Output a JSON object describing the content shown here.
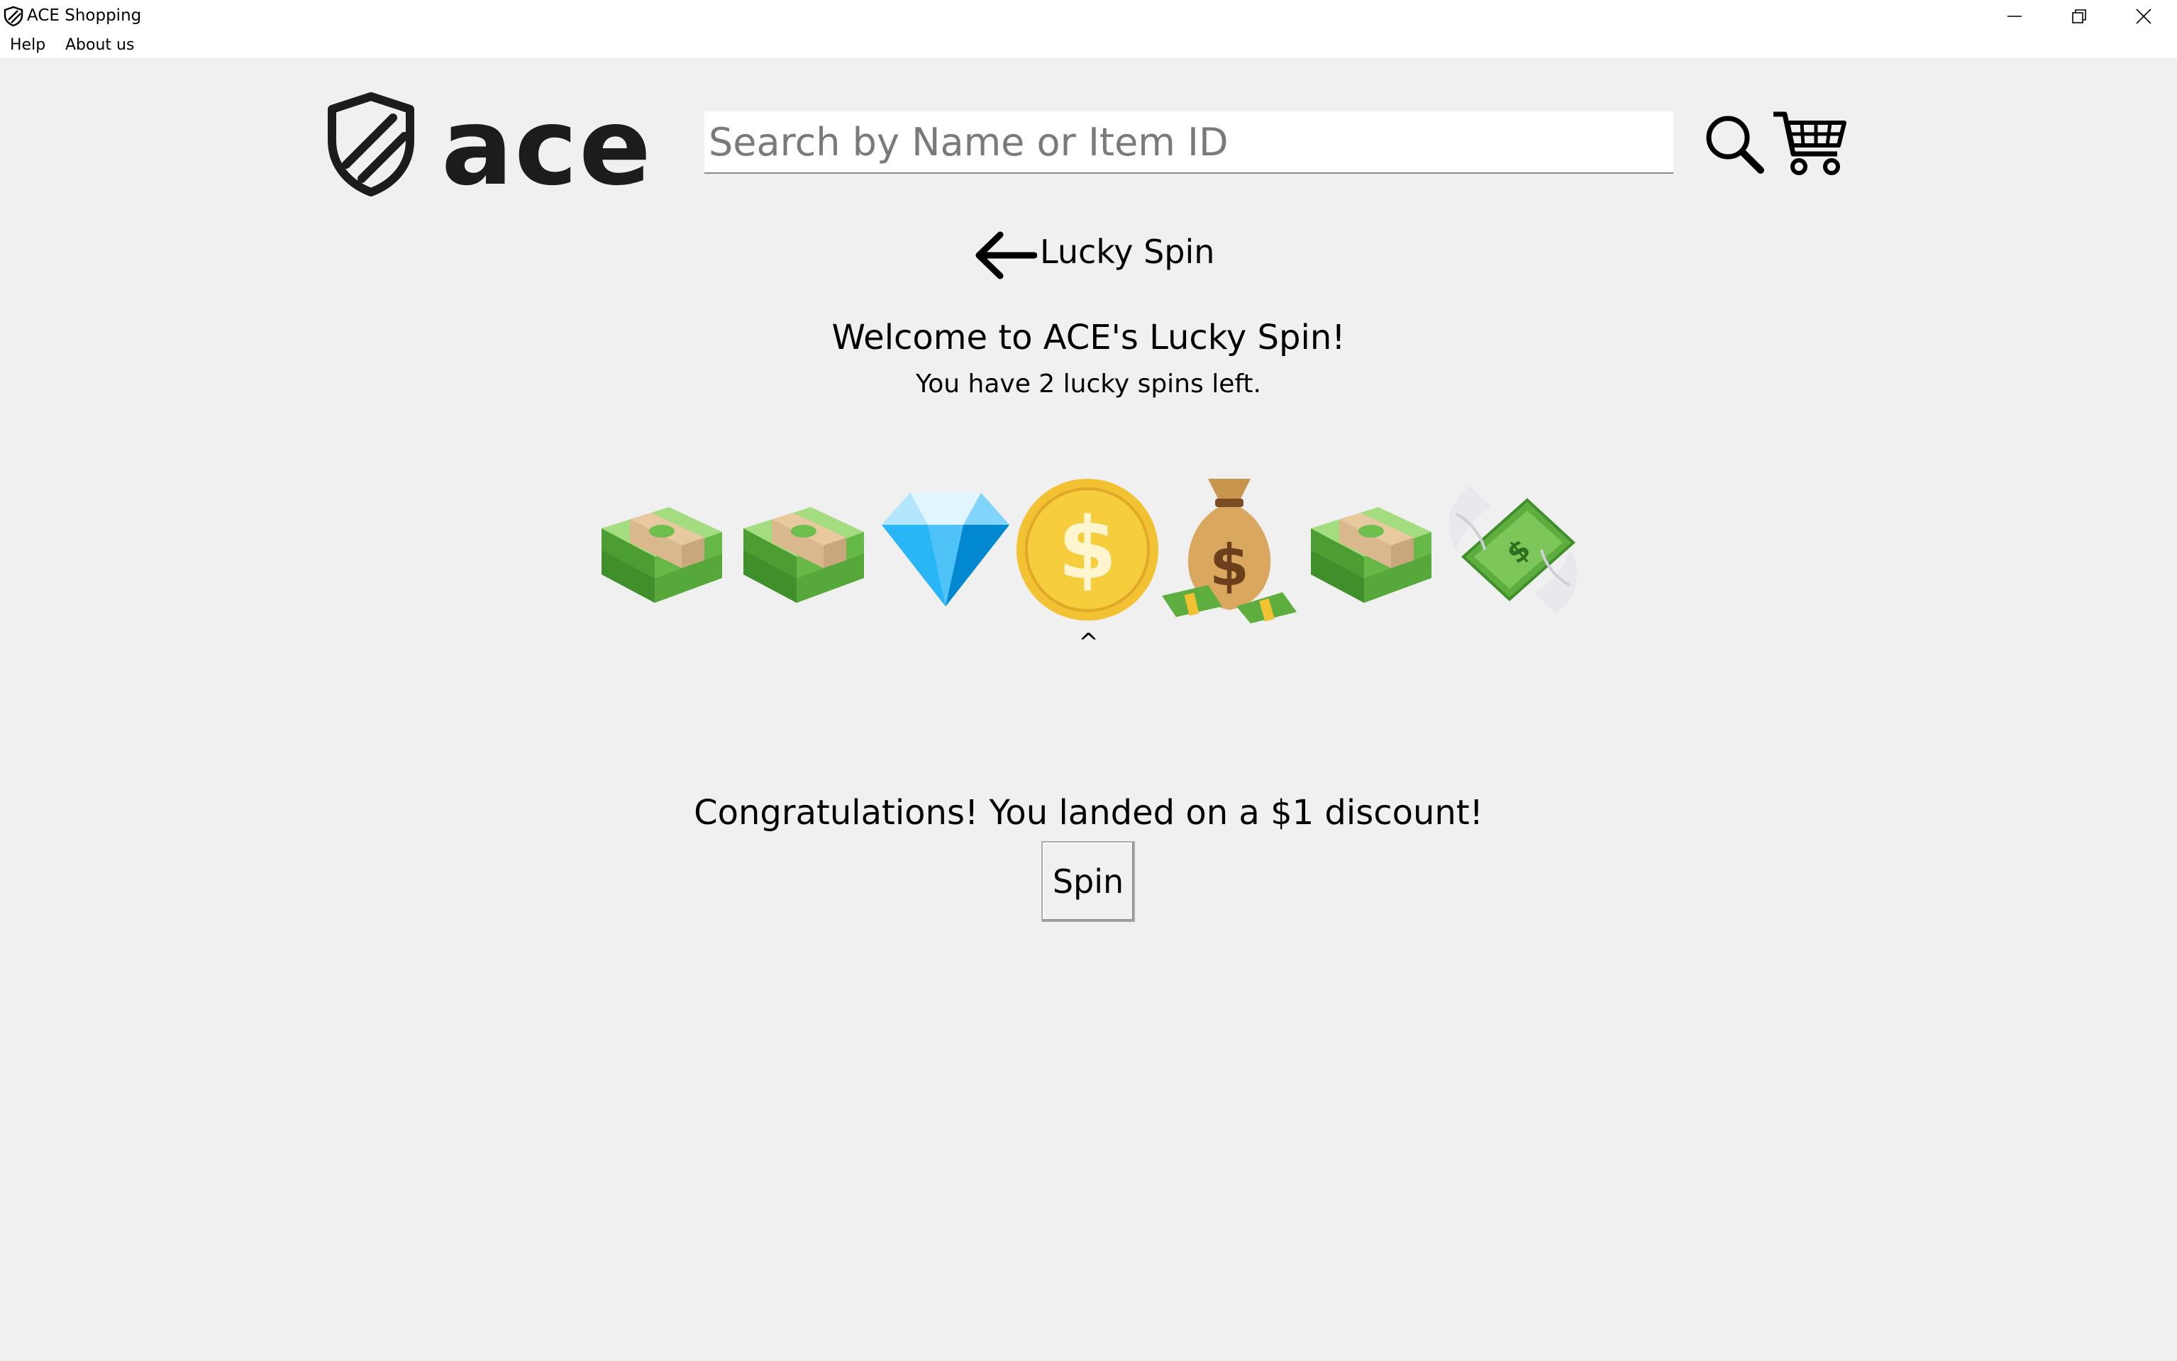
{
  "window": {
    "title": "ACE Shopping"
  },
  "menu": {
    "help": "Help",
    "about": "About us"
  },
  "header": {
    "logo_text": "ace",
    "search_placeholder": "Search by Name or Item ID",
    "search_value": ""
  },
  "page": {
    "title": "Lucky Spin",
    "welcome": "Welcome to ACE's Lucky Spin!",
    "spins_left_text": "You have 2 lucky spins left.",
    "pointer": "^",
    "result_text": "Congratulations! You landed on a $1 discount!",
    "spin_button": "Spin"
  },
  "reel": {
    "items": [
      {
        "icon": "money-stack-icon"
      },
      {
        "icon": "money-stack-icon"
      },
      {
        "icon": "diamond-icon"
      },
      {
        "icon": "gold-coin-icon"
      },
      {
        "icon": "money-bag-icon"
      },
      {
        "icon": "money-stack-icon"
      },
      {
        "icon": "money-with-wings-icon"
      }
    ],
    "selected_index": 3
  },
  "colors": {
    "background": "#f0f0f0",
    "money_green": "#5dae3e",
    "coin_gold": "#f2c232",
    "diamond_blue": "#4fc3f7"
  }
}
